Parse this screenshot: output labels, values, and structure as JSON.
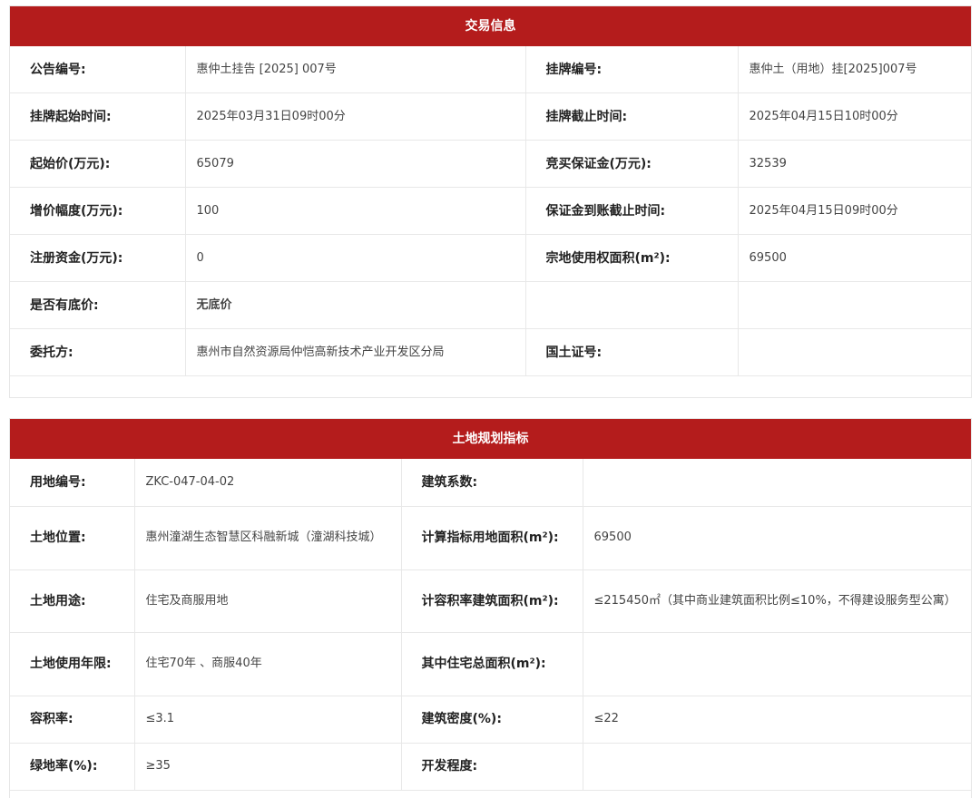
{
  "trade": {
    "title": "交易信息",
    "rows": [
      {
        "k1": "公告编号:",
        "v1": "惠仲土挂告 [2025] 007号",
        "k2": "挂牌编号:",
        "v2": "惠仲土（用地）挂[2025]007号"
      },
      {
        "k1": "挂牌起始时间:",
        "v1": "2025年03月31日09时00分",
        "k2": "挂牌截止时间:",
        "v2": "2025年04月15日10时00分"
      },
      {
        "k1": "起始价(万元):",
        "v1": "65079",
        "k2": "竞买保证金(万元):",
        "v2": "32539"
      },
      {
        "k1": "增价幅度(万元):",
        "v1": "100",
        "k2": "保证金到账截止时间:",
        "v2": "2025年04月15日09时00分"
      },
      {
        "k1": "注册资金(万元):",
        "v1": "0",
        "k2": "宗地使用权面积(m²):",
        "v2": "69500"
      },
      {
        "k1": "是否有底价:",
        "v1": "无底价",
        "k2": "",
        "v2": ""
      },
      {
        "k1": "委托方:",
        "v1": "惠州市自然资源局仲恺高新技术产业开发区分局",
        "k2": "国土证号:",
        "v2": ""
      }
    ]
  },
  "planning": {
    "title": "土地规划指标",
    "rows": [
      {
        "k1": "用地编号:",
        "v1": "ZKC-047-04-02",
        "k2": "建筑系数:",
        "v2": ""
      },
      {
        "k1": "土地位置:",
        "v1": "惠州潼湖生态智慧区科融新城（潼湖科技城）",
        "k2": "计算指标用地面积(m²):",
        "v2": "69500"
      },
      {
        "k1": "土地用途:",
        "v1": "住宅及商服用地",
        "k2": "计容积率建筑面积(m²):",
        "v2": "≤215450㎡（其中商业建筑面积比例≤10%，不得建设服务型公寓）"
      },
      {
        "k1": "土地使用年限:",
        "v1": "住宅70年 、商服40年",
        "k2": "其中住宅总面积(m²):",
        "v2": ""
      },
      {
        "k1": "容积率:",
        "v1": "≤3.1",
        "k2": "建筑密度(%):",
        "v2": "≤22"
      },
      {
        "k1": "绿地率(%):",
        "v1": "≥35",
        "k2": "开发程度:",
        "v2": ""
      }
    ]
  }
}
